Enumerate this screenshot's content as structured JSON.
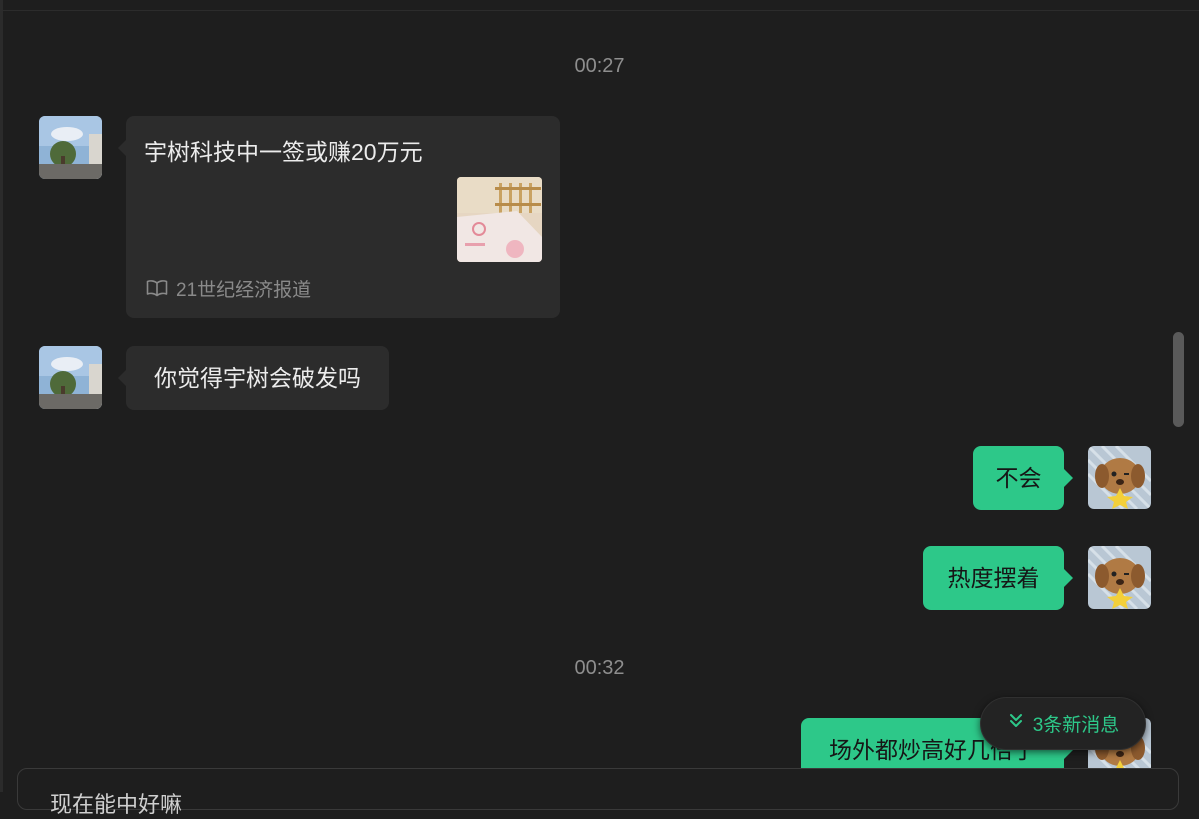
{
  "colors": {
    "background": "#1e1e1e",
    "incoming_bubble": "#2c2c2c",
    "outgoing_bubble": "#2dc889",
    "accent": "#2dc889"
  },
  "chat": {
    "timestamps": [
      "00:27",
      "00:32"
    ],
    "messages": [
      {
        "direction": "incoming",
        "type": "link-card",
        "title": "宇树科技中一签或赚20万元",
        "source": "21世纪经济报道",
        "source_icon": "book-open-icon",
        "thumbnail": "article-thumbnail"
      },
      {
        "direction": "incoming",
        "type": "text",
        "text": "你觉得宇树会破发吗"
      },
      {
        "direction": "outgoing",
        "type": "text",
        "text": "不会"
      },
      {
        "direction": "outgoing",
        "type": "text",
        "text": "热度摆着"
      },
      {
        "direction": "outgoing",
        "type": "text",
        "text": "场外都炒高好几倍了"
      }
    ],
    "new_messages_pill": {
      "icon": "double-chevron-down-icon",
      "label": "3条新消息"
    }
  },
  "composer": {
    "text": "现在能中好嘛"
  }
}
